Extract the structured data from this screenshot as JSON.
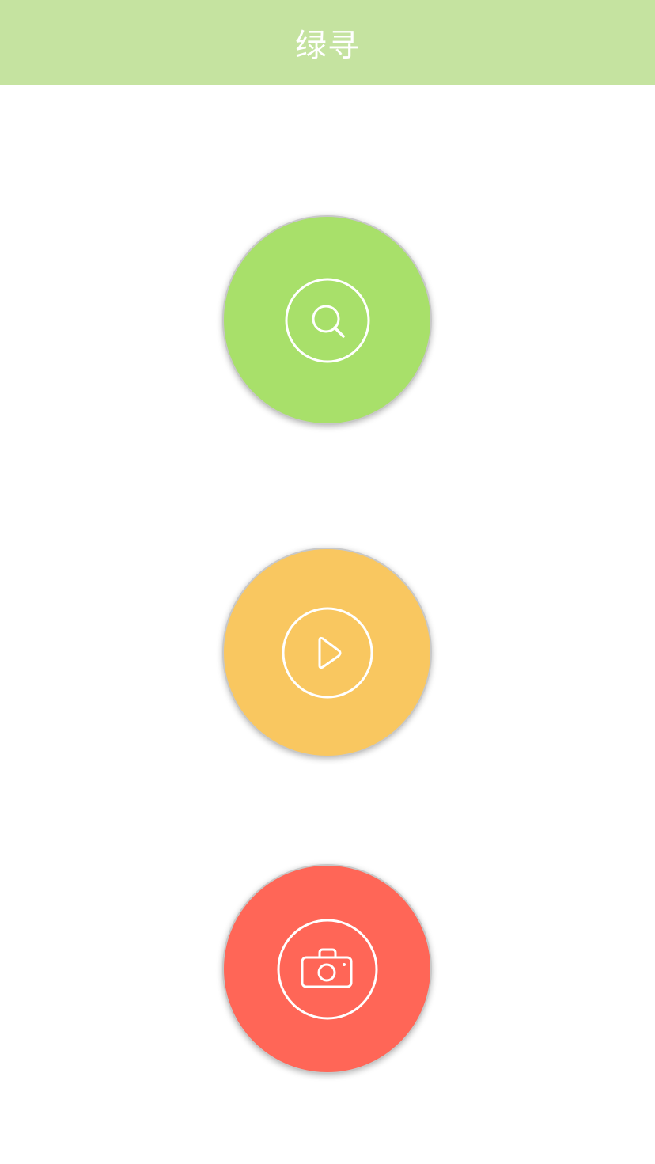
{
  "header": {
    "title": "绿寻",
    "background_color": "#c5e3a0"
  },
  "buttons": [
    {
      "name": "search",
      "icon": "search-icon",
      "color": "#a8e06a"
    },
    {
      "name": "play",
      "icon": "play-icon",
      "color": "#f9c760"
    },
    {
      "name": "camera",
      "icon": "camera-icon",
      "color": "#ff6657"
    }
  ]
}
